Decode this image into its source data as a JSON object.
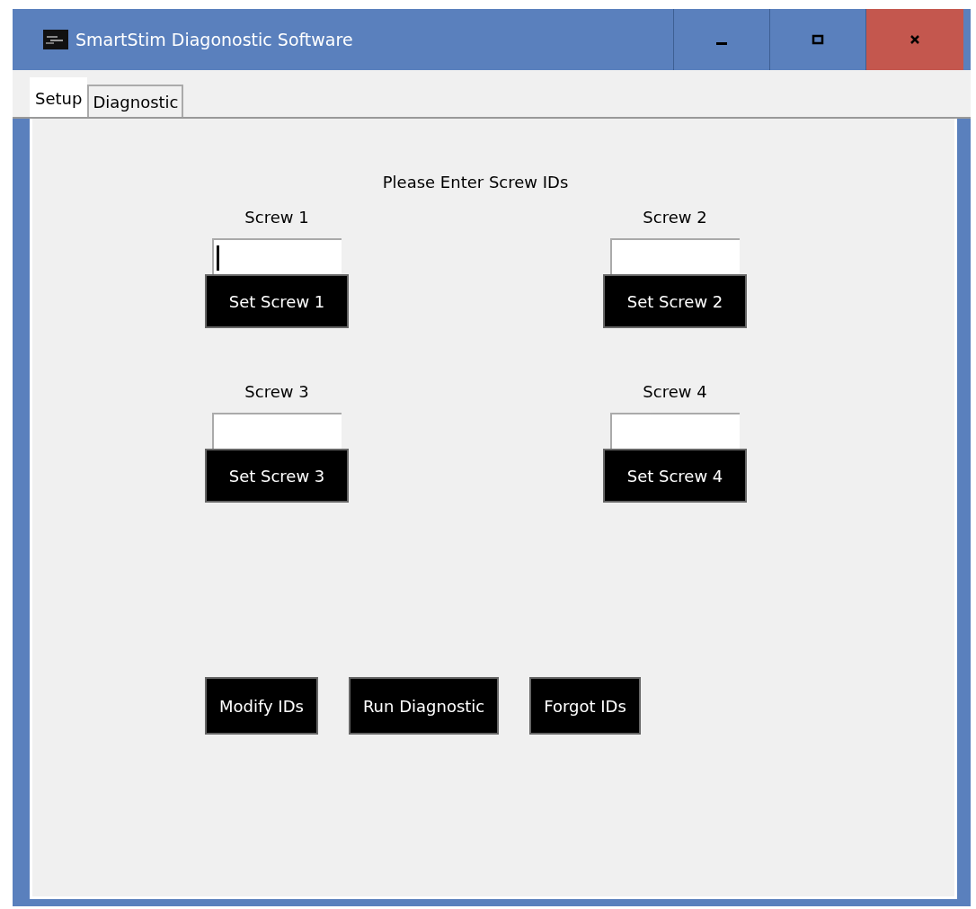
{
  "window": {
    "title": "SmartStim Diagonostic Software",
    "controls": [
      {
        "kind": "minimize"
      },
      {
        "kind": "maximize"
      },
      {
        "kind": "close"
      }
    ]
  },
  "tabs": [
    {
      "label": "Setup",
      "selected": true
    },
    {
      "label": "Diagnostic",
      "selected": false
    }
  ],
  "heading": "Please Enter Screw IDs",
  "screws": [
    {
      "label": "Screw 1",
      "button": "Set Screw 1",
      "focused": true
    },
    {
      "label": "Screw 2",
      "button": "Set Screw 2",
      "focused": false
    },
    {
      "label": "Screw 3",
      "button": "Set Screw 3",
      "focused": false
    },
    {
      "label": "Screw 4",
      "button": "Set Screw 4",
      "focused": false
    }
  ],
  "actions": [
    "Modify IDs",
    "Run Diagnostic",
    "Forgot IDs"
  ]
}
